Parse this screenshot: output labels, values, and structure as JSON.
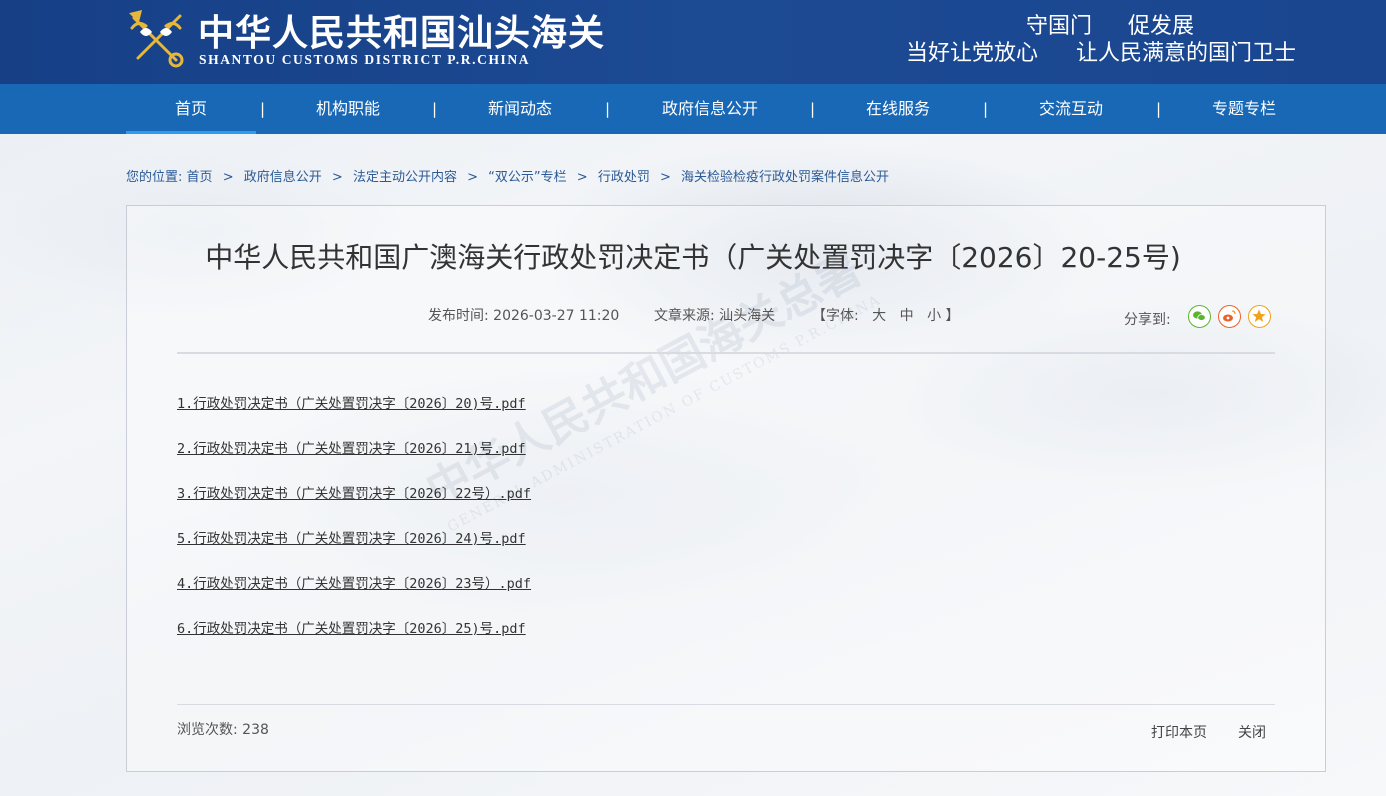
{
  "header": {
    "logo_cn": "中华人民共和国汕头海关",
    "logo_en": "SHANTOU CUSTOMS DISTRICT P.R.CHINA",
    "slogan_line1": [
      "守国门",
      "促发展"
    ],
    "slogan_line2": [
      "当好让党放心",
      "让人民满意的国门卫士"
    ]
  },
  "nav": {
    "items": [
      {
        "label": "首页",
        "active": true
      },
      {
        "label": "机构职能"
      },
      {
        "label": "新闻动态"
      },
      {
        "label": "政府信息公开"
      },
      {
        "label": "在线服务"
      },
      {
        "label": "交流互动"
      },
      {
        "label": "专题专栏"
      }
    ],
    "separator": "|"
  },
  "breadcrumb": {
    "prefix": "您的位置:",
    "items": [
      "首页",
      "政府信息公开",
      "法定主动公开内容",
      "“双公示”专栏",
      "行政处罚",
      "海关检验检疫行政处罚案件信息公开"
    ],
    "separator": ">"
  },
  "article": {
    "title": "中华人民共和国广澳海关行政处罚决定书（广关处置罚决字〔2026〕20-25号)",
    "date_label": "发布时间:",
    "date": "2026-03-27 11:20",
    "source_label": "文章来源:",
    "source": "汕头海关",
    "font_label": "【字体:",
    "font_sizes": [
      "大",
      "中",
      "小"
    ],
    "font_end": "】",
    "share_label": "分享到:",
    "share_icons": [
      "wechat-icon",
      "weibo-icon",
      "favorite-icon"
    ],
    "files": [
      "1.行政处罚决定书（广关处置罚决字〔2026〕20)号.pdf",
      "2.行政处罚决定书（广关处置罚决字〔2026〕21)号.pdf",
      "3.行政处罚决定书（广关处置罚决字〔2026〕22号）.pdf",
      "5.行政处罚决定书（广关处置罚决字〔2026〕24)号.pdf",
      "4.行政处罚决定书（广关处置罚决字〔2026〕23号）.pdf",
      "6.行政处罚决定书（广关处置罚决字〔2026〕25)号.pdf"
    ],
    "views_label": "浏览次数:",
    "views": "238",
    "print_label": "打印本页",
    "close_label": "关闭"
  },
  "watermark": {
    "line1": "中华人民共和国海关总署",
    "line2": "GENERAL ADMINISTRATION OF CUSTOMS P.R.CHINA"
  },
  "colors": {
    "header_bg": "#1a4690",
    "nav_bg": "#1868b6",
    "nav_active_underline": "#2c9bf0",
    "breadcrumb_text": "#2b5a96",
    "wechat": "#5cb531",
    "weibo": "#e8622a",
    "favorite": "#f0a21b"
  }
}
